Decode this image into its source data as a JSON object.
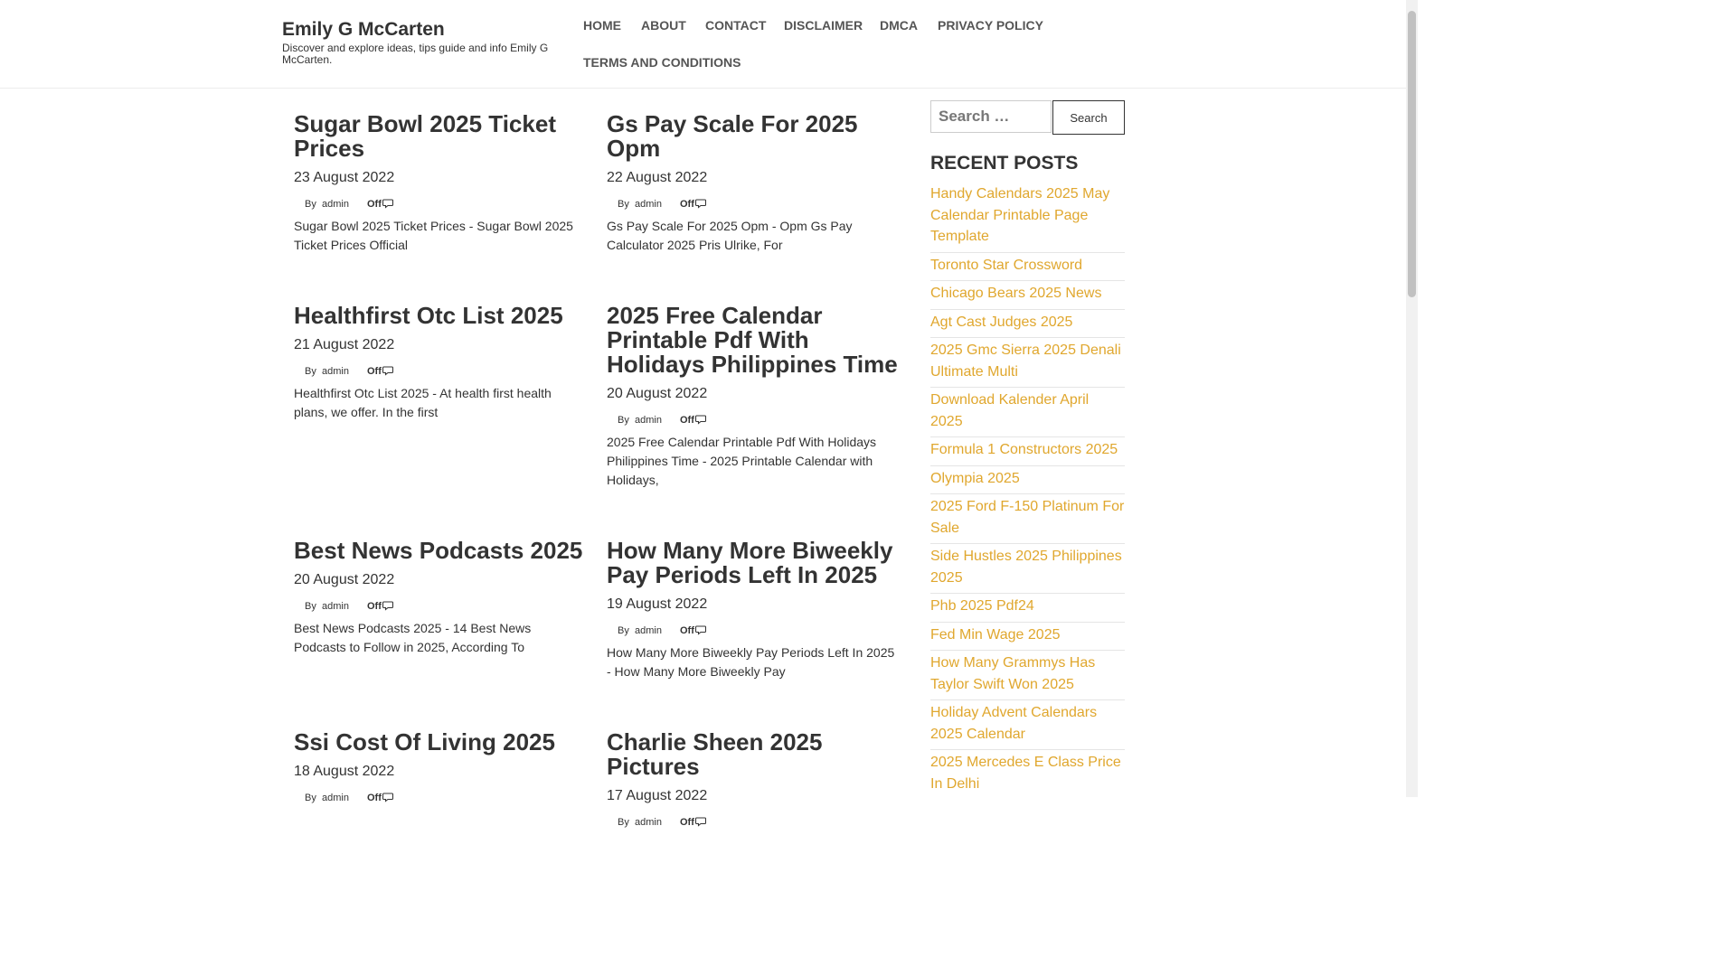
{
  "site": {
    "title": "Emily G McCarten",
    "description": "Discover and explore ideas, tips guide and info Emily G McCarten."
  },
  "nav": {
    "home": "HOME",
    "about": "ABOUT",
    "contact": "CONTACT",
    "disclaimer": "DISCLAIMER",
    "dmca": "DMCA",
    "privacy": "PRIVACY POLICY",
    "terms": "TERMS AND CONDITIONS"
  },
  "meta": {
    "by": "By",
    "author": "admin",
    "comments": "Off"
  },
  "posts": [
    {
      "title": "Sugar Bowl 2025 Ticket Prices",
      "date": "23 August 2022",
      "excerpt": "Sugar Bowl 2025 Ticket Prices - Sugar Bowl 2025 Ticket Prices Official"
    },
    {
      "title": "Gs Pay Scale For 2025 Opm",
      "date": "22 August 2022",
      "excerpt": "Gs Pay Scale For 2025 Opm - Opm Gs Pay Calculator 2025 Pris Ulrike, For"
    },
    {
      "title": "Healthfirst Otc List 2025",
      "date": "21 August 2022",
      "excerpt": "Healthfirst Otc List 2025 - At health first health plans, we offer. In the first"
    },
    {
      "title": "2025 Free Calendar Printable Pdf With Holidays Philippines Time",
      "date": "20 August 2022",
      "excerpt": "2025 Free Calendar Printable Pdf With Holidays Philippines Time - 2025 Printable Calendar with Holidays,"
    },
    {
      "title": "Best News Podcasts 2025",
      "date": "20 August 2022",
      "excerpt": "Best News Podcasts 2025 - 14 Best News Podcasts to Follow in 2025, According To"
    },
    {
      "title": "How Many More Biweekly Pay Periods Left In 2025",
      "date": "19 August 2022",
      "excerpt": "How Many More Biweekly Pay Periods Left In 2025 - How Many More Biweekly Pay"
    },
    {
      "title": "Ssi Cost Of Living 2025",
      "date": "18 August 2022",
      "excerpt": ""
    },
    {
      "title": "Charlie Sheen 2025 Pictures",
      "date": "17 August 2022",
      "excerpt": ""
    }
  ],
  "sidebar": {
    "search_placeholder": "Search …",
    "search_button": "Search",
    "recent_title": "RECENT POSTS",
    "recent_posts": [
      "Handy Calendars 2025 May Calendar Printable Page Template",
      "Toronto Star Crossword",
      "Chicago Bears 2025 News",
      "Agt Cast Judges 2025",
      "2025 Gmc Sierra 2025 Denali Ultimate Multi",
      "Download Kalender April 2025",
      "Formula 1 Constructors 2025",
      "Olympia 2025",
      "2025 Ford F-150 Platinum For Sale",
      "Side Hustles 2025 Philippines 2025",
      "Phb 2025 Pdf24",
      "Fed Min Wage 2025",
      "How Many Grammys Has Taylor Swift Won 2025",
      "Holiday Advent Calendars 2025 Calendar",
      "2025 Mercedes E Class Price In Delhi"
    ]
  },
  "colors": {
    "link": "#e0a72e",
    "text": "#333333"
  }
}
